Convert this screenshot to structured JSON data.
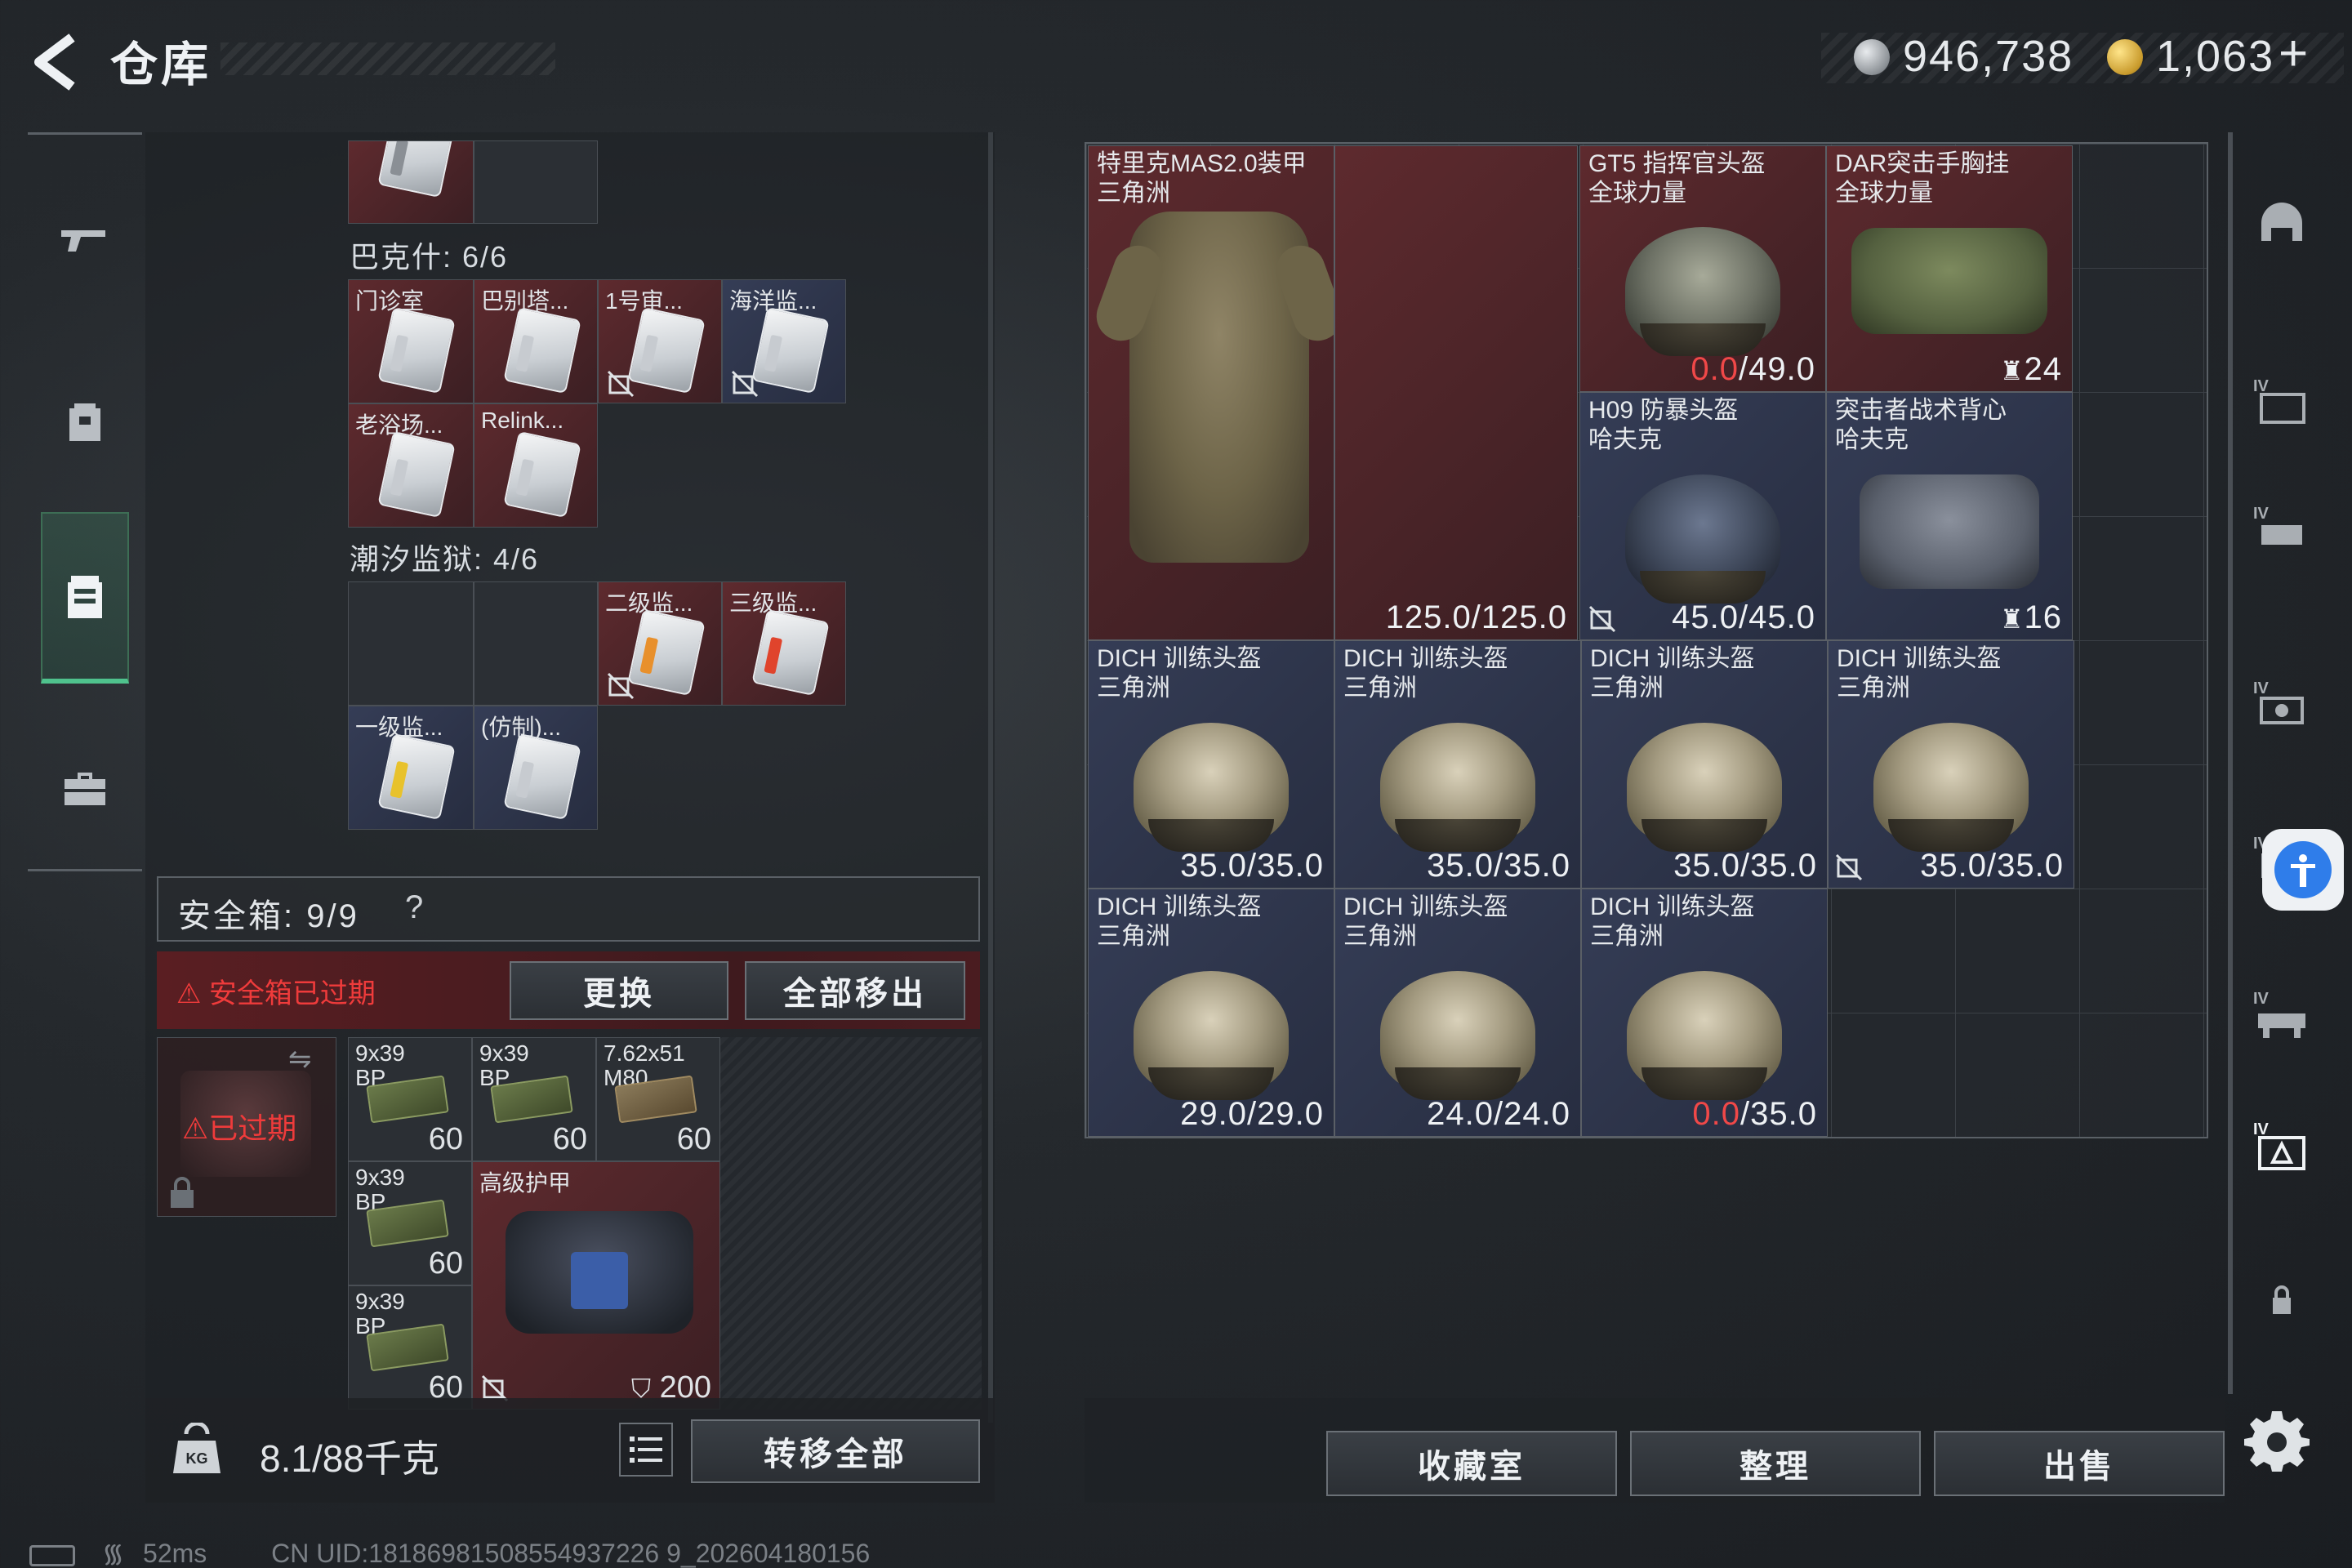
{
  "header": {
    "title": "仓库",
    "silver_value": "946,738",
    "gold_value": "1,063",
    "gold_plus": "+"
  },
  "left_panel": {
    "section_bakshi": "巴克什: 6/6",
    "bakshi_items": [
      "门诊室",
      "巴别塔...",
      "1号审...",
      "海洋监...",
      "老浴场...",
      "Relink..."
    ],
    "section_prison": "潮汐监狱: 4/6",
    "prison_items": [
      "二级监...",
      "三级监...",
      "一级监...",
      "(仿制)..."
    ],
    "safe_box": {
      "label": "安全箱: 9/9",
      "help": "?",
      "expired_notice": "安全箱已过期",
      "replace_button": "更换",
      "remove_all_button": "全部移出",
      "expired_tag": "已过期"
    },
    "safe_items": [
      {
        "name": "9x39 BP",
        "count": "60"
      },
      {
        "name": "9x39 BP",
        "count": "60"
      },
      {
        "name": "7.62x51 M80",
        "count": "60"
      },
      {
        "name": "9x39 BP",
        "count": "60"
      },
      {
        "name": "高级护甲",
        "count": "200"
      },
      {
        "name": "9x39 BP",
        "count": "60"
      }
    ],
    "weight": "8.1/88千克",
    "transfer_all_button": "转移全部"
  },
  "right_grid": {
    "items": [
      {
        "name": "特里克MAS2.0装甲",
        "sub": "三角洲",
        "dura": "125.0/125.0"
      },
      {
        "name": "GT5 指挥官头盔",
        "sub": "全球力量",
        "dura_cur": "0.0",
        "dura_max": "/49.0"
      },
      {
        "name": "DAR突击手胸挂",
        "sub": "全球力量",
        "count": "24"
      },
      {
        "name": "H09 防暴头盔",
        "sub": "哈夫克",
        "dura": "45.0/45.0"
      },
      {
        "name": "突击者战术背心",
        "sub": "哈夫克",
        "count": "16"
      },
      {
        "name": "DICH 训练头盔",
        "sub": "三角洲",
        "dura": "35.0/35.0"
      },
      {
        "name": "DICH 训练头盔",
        "sub": "三角洲",
        "dura": "35.0/35.0"
      },
      {
        "name": "DICH 训练头盔",
        "sub": "三角洲",
        "dura": "35.0/35.0"
      },
      {
        "name": "DICH 训练头盔",
        "sub": "三角洲",
        "dura": "35.0/35.0"
      },
      {
        "name": "DICH 训练头盔",
        "sub": "三角洲",
        "dura": "29.0/29.0"
      },
      {
        "name": "DICH 训练头盔",
        "sub": "三角洲",
        "dura": "24.0/24.0"
      },
      {
        "name": "DICH 训练头盔",
        "sub": "三角洲",
        "dura_cur": "0.0",
        "dura_max": "/35.0"
      }
    ],
    "collection_button": "收藏室",
    "sort_button": "整理",
    "sell_button": "出售"
  },
  "status": {
    "ping": "52ms",
    "uid": "CN UID:18186981508554937226 9_202604180156"
  },
  "colors": {
    "accent_green": "#4fc28d",
    "danger_red": "#ef3b3b",
    "cell_red": "#5e2a2e",
    "cell_blue": "#353d56"
  }
}
